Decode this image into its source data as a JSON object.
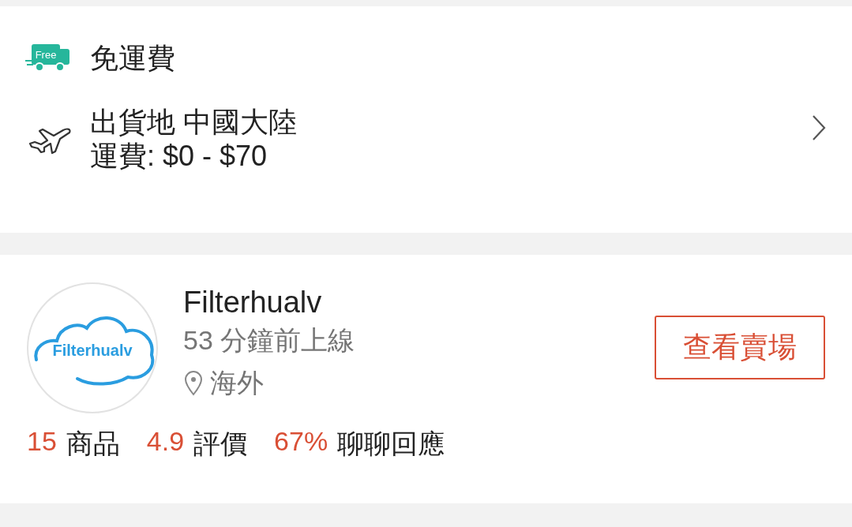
{
  "shipping": {
    "free_badge": "Free",
    "free_label": "免運費",
    "origin": "出貨地 中國大陸",
    "fee": "運費: $0 - $70"
  },
  "shop": {
    "logo_text": "Filterhualv",
    "name": "Filterhualv",
    "last_online": "53 分鐘前上線",
    "location": "海外",
    "button": "查看賣場",
    "stats": [
      {
        "number": "15",
        "caption": "商品"
      },
      {
        "number": "4.9",
        "caption": "評價"
      },
      {
        "number": "67%",
        "caption": "聊聊回應"
      }
    ]
  }
}
